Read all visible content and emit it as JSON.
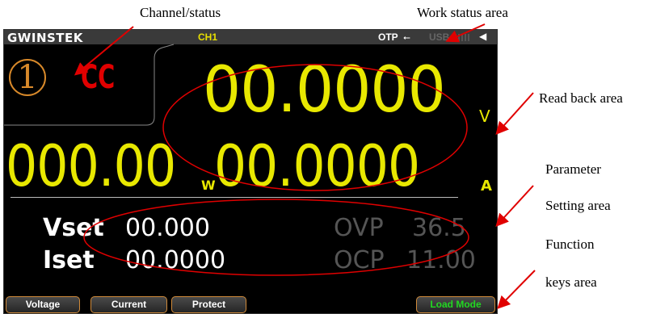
{
  "device": {
    "brand": "GWINSTEK",
    "channel_label": "CH1",
    "otp": "OTP",
    "usb": "USB",
    "channel_number": "1",
    "mode": "CC"
  },
  "readback": {
    "voltage": "00.0000",
    "voltage_unit": "V",
    "power": "000.00",
    "power_unit": "W",
    "current": "00.0000",
    "current_unit": "A"
  },
  "settings": {
    "vset_label": "Vset",
    "vset_value": "00.000",
    "iset_label": "Iset",
    "iset_value": "00.0000",
    "ovp_label": "OVP",
    "ovp_value": "36.5",
    "ocp_label": "OCP",
    "ocp_value": "11.00"
  },
  "function_keys": [
    "Voltage",
    "Current",
    "Protect",
    "Load Mode"
  ],
  "callouts": {
    "channel_status": "Channel/status",
    "work_status": "Work status area",
    "read_back": "Read back area",
    "parameter_1": "Parameter",
    "parameter_2": "Setting area",
    "function_1": "Function",
    "function_2": "keys area"
  },
  "colors": {
    "readout": "#e8e800",
    "mode": "#e00000",
    "channel": "#d8892a",
    "annotation": "#e00000",
    "load_mode": "#22d822"
  }
}
